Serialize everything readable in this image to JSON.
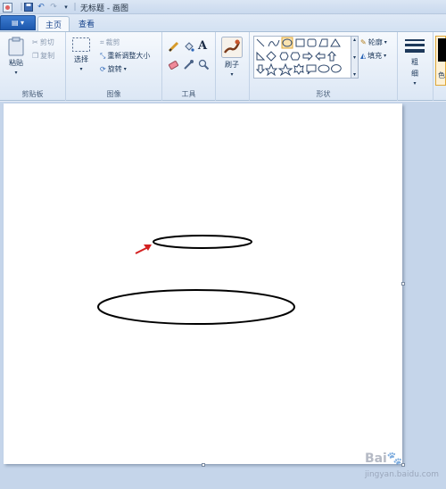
{
  "window": {
    "title": "无标题 - 画图"
  },
  "tabs": [
    "主页",
    "查看"
  ],
  "clipboard": {
    "paste": "粘贴",
    "cut": "剪切",
    "copy": "复制",
    "group": "剪贴板"
  },
  "image": {
    "select": "选择",
    "crop": "裁剪",
    "resize": "重新调整大小",
    "rotate": "旋转",
    "group": "图像"
  },
  "tools": {
    "group": "工具"
  },
  "brushes": {
    "label": "刷子"
  },
  "shapes": {
    "outline": "轮廓",
    "fill": "填充",
    "group": "形状"
  },
  "size": {
    "label1": "粗",
    "label2": "细"
  },
  "colors": {
    "label": "色",
    "primary": "#000000",
    "accent": "#f5a623"
  },
  "watermark": {
    "text": "Bai",
    "sub": "jingyan.baidu.com"
  }
}
